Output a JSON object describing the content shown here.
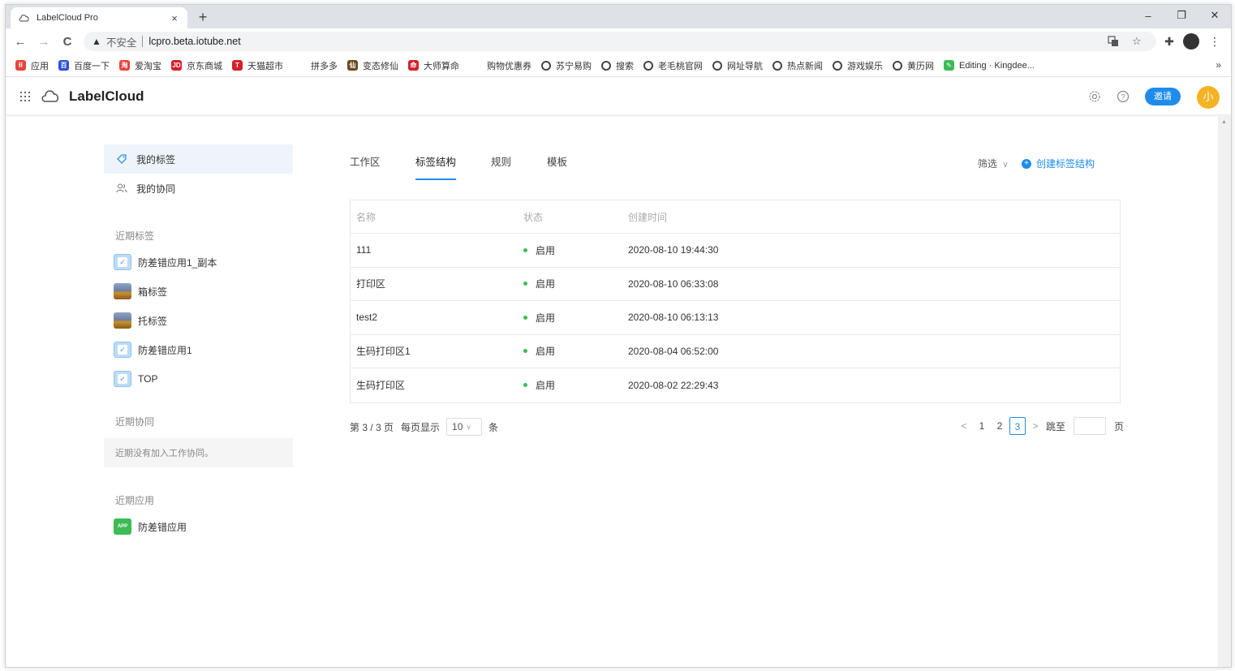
{
  "browser": {
    "tab_title": "LabelCloud Pro",
    "tab_close": "×",
    "new_tab": "+",
    "window_controls": {
      "minimize": "–",
      "restore": "❐",
      "close": "✕"
    },
    "nav": {
      "back": "←",
      "forward": "→",
      "reload": "C"
    },
    "address": {
      "warning_glyph": "▲",
      "insecure_label": "不安全",
      "url": "lcpro.beta.iotube.net"
    },
    "bookmarks": [
      {
        "label": "应用",
        "color": "#e8453c",
        "glyph": "⠿"
      },
      {
        "label": "百度一下",
        "color": "#2b4fd6",
        "glyph": "百"
      },
      {
        "label": "爱淘宝",
        "color": "#e8453c",
        "glyph": "淘"
      },
      {
        "label": "京东商城",
        "color": "#d4202a",
        "glyph": "JD"
      },
      {
        "label": "天猫超市",
        "color": "#d4202a",
        "glyph": "T"
      },
      {
        "label": "拼多多",
        "color": "",
        "glyph": ""
      },
      {
        "label": "变态修仙",
        "color": "#6b4a1f",
        "glyph": "仙"
      },
      {
        "label": "大师算命",
        "color": "#d4202a",
        "glyph": "命"
      },
      {
        "label": "购物优惠券",
        "color": "",
        "glyph": ""
      },
      {
        "label": "苏宁易购",
        "color": "globe",
        "glyph": ""
      },
      {
        "label": "搜索",
        "color": "globe",
        "glyph": ""
      },
      {
        "label": "老毛桃官网",
        "color": "globe",
        "glyph": ""
      },
      {
        "label": "网址导航",
        "color": "globe",
        "glyph": ""
      },
      {
        "label": "热点新闻",
        "color": "globe",
        "glyph": ""
      },
      {
        "label": "游戏娱乐",
        "color": "globe",
        "glyph": ""
      },
      {
        "label": "黄历网",
        "color": "globe",
        "glyph": ""
      },
      {
        "label": "Editing · Kingdee...",
        "color": "#3dbb54",
        "glyph": "✎"
      }
    ],
    "bookmarks_more": "»"
  },
  "app": {
    "brand": "LabelCloud",
    "invite_label": "邀请",
    "avatar_text": "小",
    "accent": "#1f8ceb"
  },
  "sidebar": {
    "nav": [
      {
        "label": "我的标签",
        "icon": "tag-icon",
        "active": true
      },
      {
        "label": "我的协同",
        "icon": "users-icon",
        "active": false
      }
    ],
    "recent_labels_title": "近期标签",
    "recent_labels": [
      {
        "label": "防差错应用1_副本",
        "thumb": "check"
      },
      {
        "label": "箱标签",
        "thumb": "photo"
      },
      {
        "label": "托标签",
        "thumb": "photo"
      },
      {
        "label": "防差错应用1",
        "thumb": "check"
      },
      {
        "label": "TOP",
        "thumb": "check"
      }
    ],
    "recent_collab_title": "近期协同",
    "recent_collab_empty": "近期没有加入工作协同。",
    "recent_apps_title": "近期应用",
    "recent_apps": [
      {
        "label": "防差错应用",
        "thumb_text": "APP"
      }
    ]
  },
  "main": {
    "tabs": [
      {
        "label": "工作区",
        "active": false
      },
      {
        "label": "标签结构",
        "active": true
      },
      {
        "label": "规则",
        "active": false
      },
      {
        "label": "模板",
        "active": false
      }
    ],
    "filter_label": "筛选",
    "create_label": "创建标签结构",
    "table": {
      "headers": [
        "名称",
        "状态",
        "创建时间"
      ],
      "rows": [
        {
          "name": "111",
          "status": "启用",
          "created": "2020-08-10 19:44:30"
        },
        {
          "name": "打印区",
          "status": "启用",
          "created": "2020-08-10 06:33:08"
        },
        {
          "name": "test2",
          "status": "启用",
          "created": "2020-08-10 06:13:13"
        },
        {
          "name": "生码打印区1",
          "status": "启用",
          "created": "2020-08-04 06:52:00"
        },
        {
          "name": "生码打印区",
          "status": "启用",
          "created": "2020-08-02 22:29:43"
        }
      ]
    },
    "pagination": {
      "page_info": "第 3 / 3 页",
      "per_page_label": "每页显示",
      "per_page_value": "10",
      "per_page_unit": "条",
      "prev": "<",
      "pages": [
        "1",
        "2",
        "3"
      ],
      "current_page": "3",
      "next": ">",
      "jump_label": "跳至",
      "jump_unit": "页"
    }
  }
}
